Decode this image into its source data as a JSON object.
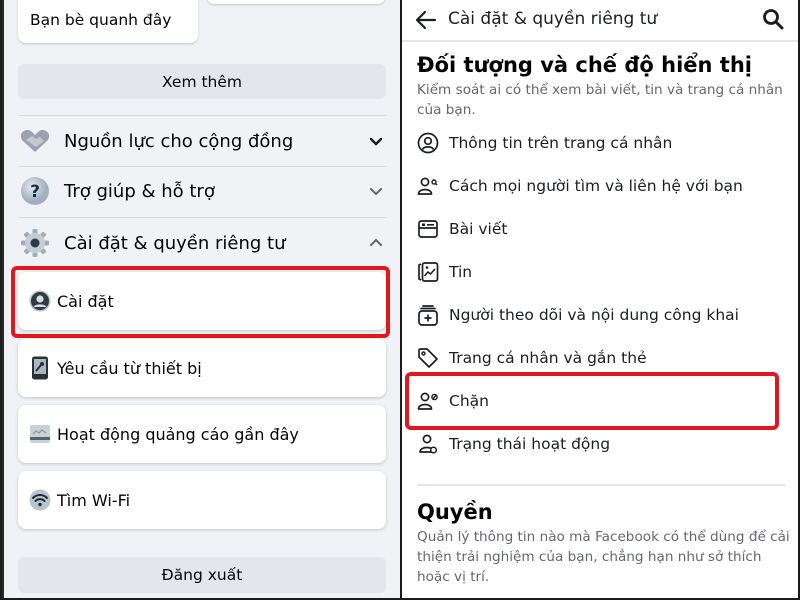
{
  "left_panel": {
    "shortcut_card_label": "Bạn bè quanh đây",
    "see_more_label": "Xem thêm",
    "sections": [
      {
        "label": "Nguồn lực cho cộng đồng",
        "icon": "handshake-icon",
        "state": "collapsed"
      },
      {
        "label": "Trợ giúp & hỗ trợ",
        "icon": "help-question-icon",
        "state": "collapsed"
      },
      {
        "label": "Cài đặt & quyền riêng tư",
        "icon": "gear-icon",
        "state": "expanded"
      }
    ],
    "settings_items": [
      {
        "label": "Cài đặt",
        "icon": "user-circle-icon",
        "highlighted": true
      },
      {
        "label": "Yêu cầu từ thiết bị",
        "icon": "phone-key-icon",
        "highlighted": false
      },
      {
        "label": "Hoạt động quảng cáo gần đây",
        "icon": "ad-activity-icon",
        "highlighted": false
      },
      {
        "label": "Tìm Wi-Fi",
        "icon": "wifi-icon",
        "highlighted": false
      }
    ],
    "logout_label": "Đăng xuất"
  },
  "right_panel": {
    "header": {
      "title": "Cài đặt & quyền riêng tư",
      "back_icon": "arrow-left-icon",
      "search_icon": "search-icon"
    },
    "audience_section": {
      "title": "Đối tượng và chế độ hiển thị",
      "description": "Kiểm soát ai có thể xem bài viết, tin và trang cá nhân của bạn.",
      "items": [
        {
          "label": "Thông tin trên trang cá nhân",
          "icon": "profile-circle-icon"
        },
        {
          "label": "Cách mọi người tìm và liên hệ với bạn",
          "icon": "people-search-icon"
        },
        {
          "label": "Bài viết",
          "icon": "post-icon"
        },
        {
          "label": "Tin",
          "icon": "stories-icon"
        },
        {
          "label": "Người theo dõi và nội dung công khai",
          "icon": "followers-icon"
        },
        {
          "label": "Trang cá nhân và gắn thẻ",
          "icon": "tag-icon"
        },
        {
          "label": "Chặn",
          "icon": "block-user-icon",
          "highlighted": true
        },
        {
          "label": "Trạng thái hoạt động",
          "icon": "active-status-icon"
        }
      ]
    },
    "permissions_section": {
      "title": "Quyền",
      "description": "Quản lý thông tin nào mà Facebook có thể dùng để cải thiện trải nghiệm của bạn, chẳng hạn như sở thích hoặc vị trí."
    }
  },
  "colors": {
    "highlight": "#e0171f",
    "left_bg": "#f0f2f5",
    "button_bg": "#e4e6eb",
    "secondary_text": "#65676b",
    "accent_blue": "#1877f2"
  }
}
